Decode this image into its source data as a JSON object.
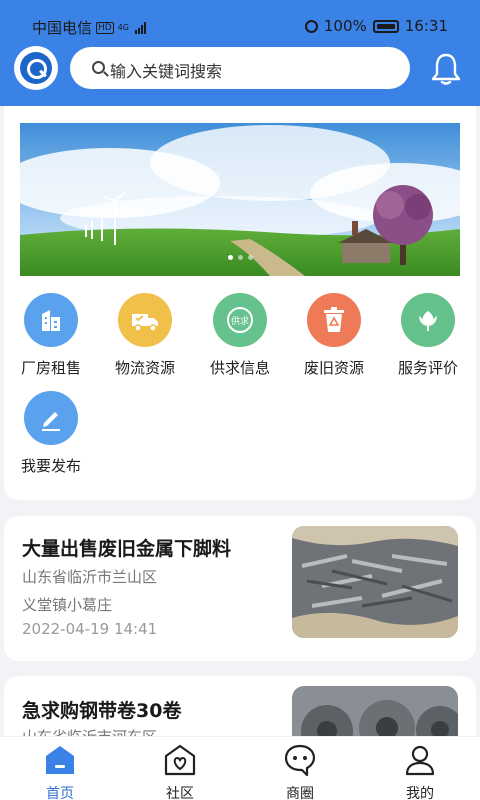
{
  "status_bar": {
    "carrier": "中国电信",
    "hd": "HD",
    "network": "4G",
    "battery": "100%",
    "time": "16:31"
  },
  "header": {
    "search_placeholder": "输入关键词搜索"
  },
  "grid": [
    {
      "label": "厂房租售",
      "icon": "building-icon",
      "color": "#5aa2ee"
    },
    {
      "label": "物流资源",
      "icon": "truck-icon",
      "color": "#f0c04a"
    },
    {
      "label": "供求信息",
      "icon": "supply-demand-icon",
      "color": "#66c28c"
    },
    {
      "label": "废旧资源",
      "icon": "recycle-bin-icon",
      "color": "#ee7a57"
    },
    {
      "label": "服务评价",
      "icon": "flower-icon",
      "color": "#66c28c"
    },
    {
      "label": "我要发布",
      "icon": "edit-icon",
      "color": "#5aa2ee"
    }
  ],
  "listings": [
    {
      "title": "大量出售废旧金属下脚料",
      "location1": "山东省临沂市兰山区",
      "location2": "义堂镇小葛庄",
      "time": "2022-04-19 14:41"
    },
    {
      "title": "急求购钢带卷30卷",
      "location1": "山东省临沂市河东区"
    }
  ],
  "bottom_nav": [
    {
      "label": "首页",
      "icon": "home-icon"
    },
    {
      "label": "社区",
      "icon": "community-icon"
    },
    {
      "label": "商圈",
      "icon": "chat-icon"
    },
    {
      "label": "我的",
      "icon": "profile-icon"
    }
  ],
  "colors": {
    "header": "#3b82e6",
    "active": "#2f6fd6"
  }
}
